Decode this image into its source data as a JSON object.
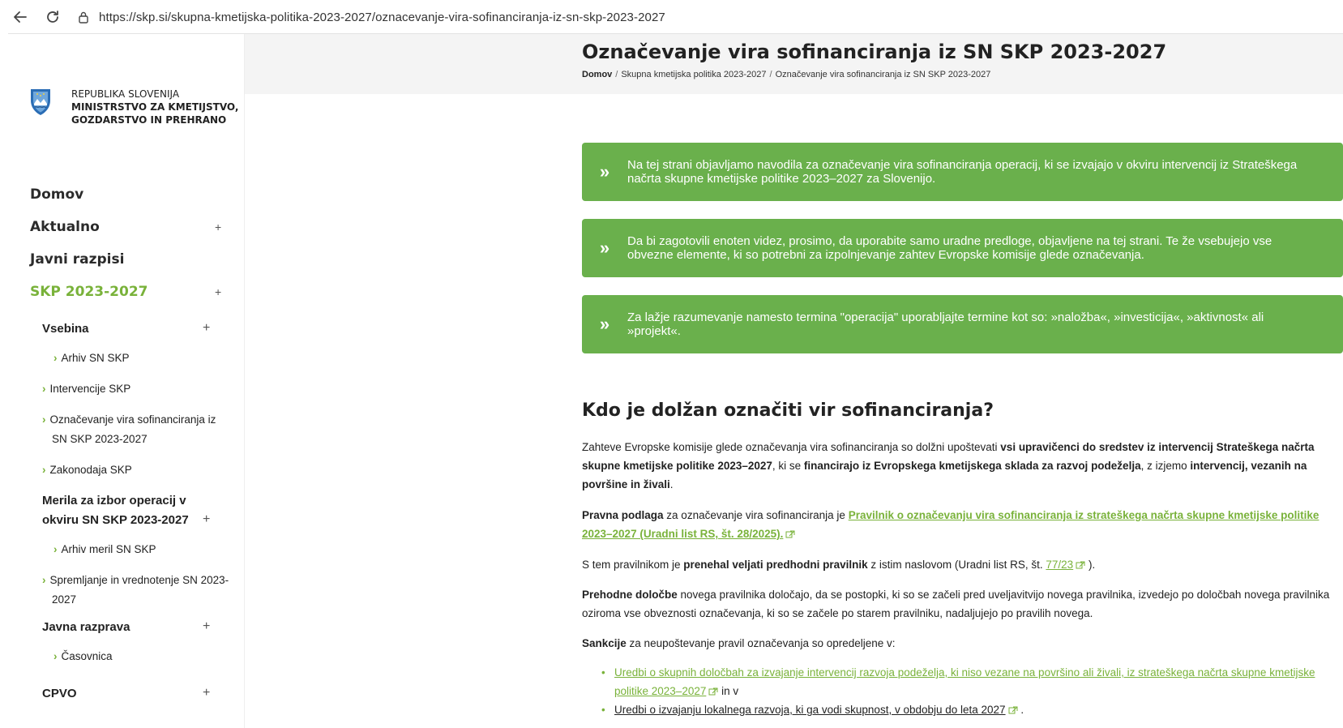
{
  "browser": {
    "back_icon": "arrow-left-icon",
    "reload_icon": "reload-icon",
    "lock_icon": "lock-icon",
    "url": "https://skp.si/skupna-kmetijska-politika-2023-2027/oznacevanje-vira-sofinanciranja-iz-sn-skp-2023-2027"
  },
  "logo": {
    "line1": "REPUBLIKA SLOVENIJA",
    "line2": "MINISTRSTVO ZA KMETIJSTVO,",
    "line3": "GOZDARSTVO IN PREHRANO"
  },
  "sidebar": {
    "domov": "Domov",
    "aktualno": "Aktualno",
    "javni_razpisi": "Javni razpisi",
    "skp": "SKP 2023-2027",
    "plus": "+",
    "vsebina": "Vsebina",
    "arhiv_sn_skp": "Arhiv SN SKP",
    "intervencije_skp": "Intervencije SKP",
    "oznacevanje_l1": "Označevanje vira sofinanciranja iz",
    "oznacevanje_l2": "SN SKP 2023-2027",
    "zakonodaja": "Zakonodaja SKP",
    "merila_l1": "Merila za izbor operacij v",
    "merila_l2": "okviru SN SKP 2023-2027",
    "arhiv_meril": "Arhiv meril SN SKP",
    "spremljanje_l1": "Spremljanje in vrednotenje SN 2023-",
    "spremljanje_l2": "2027",
    "javna_razprava": "Javna razprava",
    "casovnica": "Časovnica",
    "cpvo": "CPVO",
    "chevron": "›",
    "accent": "#79b23a"
  },
  "header": {
    "title": "Označevanje vira sofinanciranja iz SN SKP 2023-2027",
    "bc_home": "Domov",
    "bc_sep": "/",
    "bc_skp": "Skupna kmetijska politika 2023-2027",
    "bc_current": "Označevanje vira sofinanciranja iz SN SKP 2023-2027"
  },
  "notices": {
    "icon": "»",
    "n1": "Na tej strani objavljamo navodila za označevanje vira sofinanciranja operacij, ki se izvajajo v okviru intervencij iz Strateškega načrta skupne kmetijske politike 2023–2027 za Slovenijo.",
    "n2": "Da bi zagotovili enoten videz, prosimo, da uporabite samo uradne predloge, objavljene na tej strani. Te že vsebujejo vse obvezne elemente, ki so potrebni za izpolnjevanje zahtev Evropske komisije glede označevanja.",
    "n3": "Za lažje razumevanje namesto termina \"operacija\" uporabljajte termine kot so: »naložba«, »investicija«, »aktivnost« ali »projekt«.",
    "color": "#6ab04c"
  },
  "content": {
    "heading": "Kdo je dolžan označiti vir sofinanciranja?",
    "p1_a": "Zahteve Evropske komisije glede označevanja vira sofinanciranja so dolžni upoštevati ",
    "p1_b": "vsi upravičenci do sredstev iz intervencij Strateškega načrta skupne kmetijske politike 2023–2027",
    "p1_c": ", ki se ",
    "p1_d": "financirajo iz Evropskega kmetijskega sklada za razvoj podeželja",
    "p1_e": ", z izjemo ",
    "p1_f": "intervencij, vezanih na površine in živali",
    "p1_g": ".",
    "p2_a": "Pravna podlaga",
    "p2_b": " za označevanje vira sofinanciranja je ",
    "p2_link": "Pravilnik o označevanju vira sofinanciranja iz strateškega načrta skupne kmetijske politike 2023–2027 (Uradni list RS, št. 28/2025).",
    "p3_a": "S tem pravilnikom je ",
    "p3_b": "prenehal veljati predhodni pravilnik",
    "p3_c": " z istim naslovom (Uradni list RS, št. ",
    "p3_link": "77/23",
    "p3_d": " ).",
    "p4_a": "Prehodne določbe",
    "p4_b": " novega pravilnika določajo, da se postopki, ki so se začeli pred uveljavitvijo novega pravilnika, izvedejo po določbah novega pravilnika oziroma vse obveznosti označevanja, ki so se začele po starem pravilniku, nadaljujejo po pravilih novega.",
    "p5_a": "Sankcije",
    "p5_b": " za neupoštevanje pravil označevanja so opredeljene v:",
    "b1_link": "Uredbi o skupnih določbah za izvajanje intervencij razvoja podeželja, ki niso vezane na površino ali živali, iz strateškega načrta skupne kmetijske politike 2023–2027",
    "b1_after": " in v",
    "b2_link": "Uredbi o izvajanju lokalnega razvoja, ki ga vodi skupnost, v obdobju do leta 2027",
    "b2_after": " .",
    "external_icon": "external-link-icon"
  }
}
